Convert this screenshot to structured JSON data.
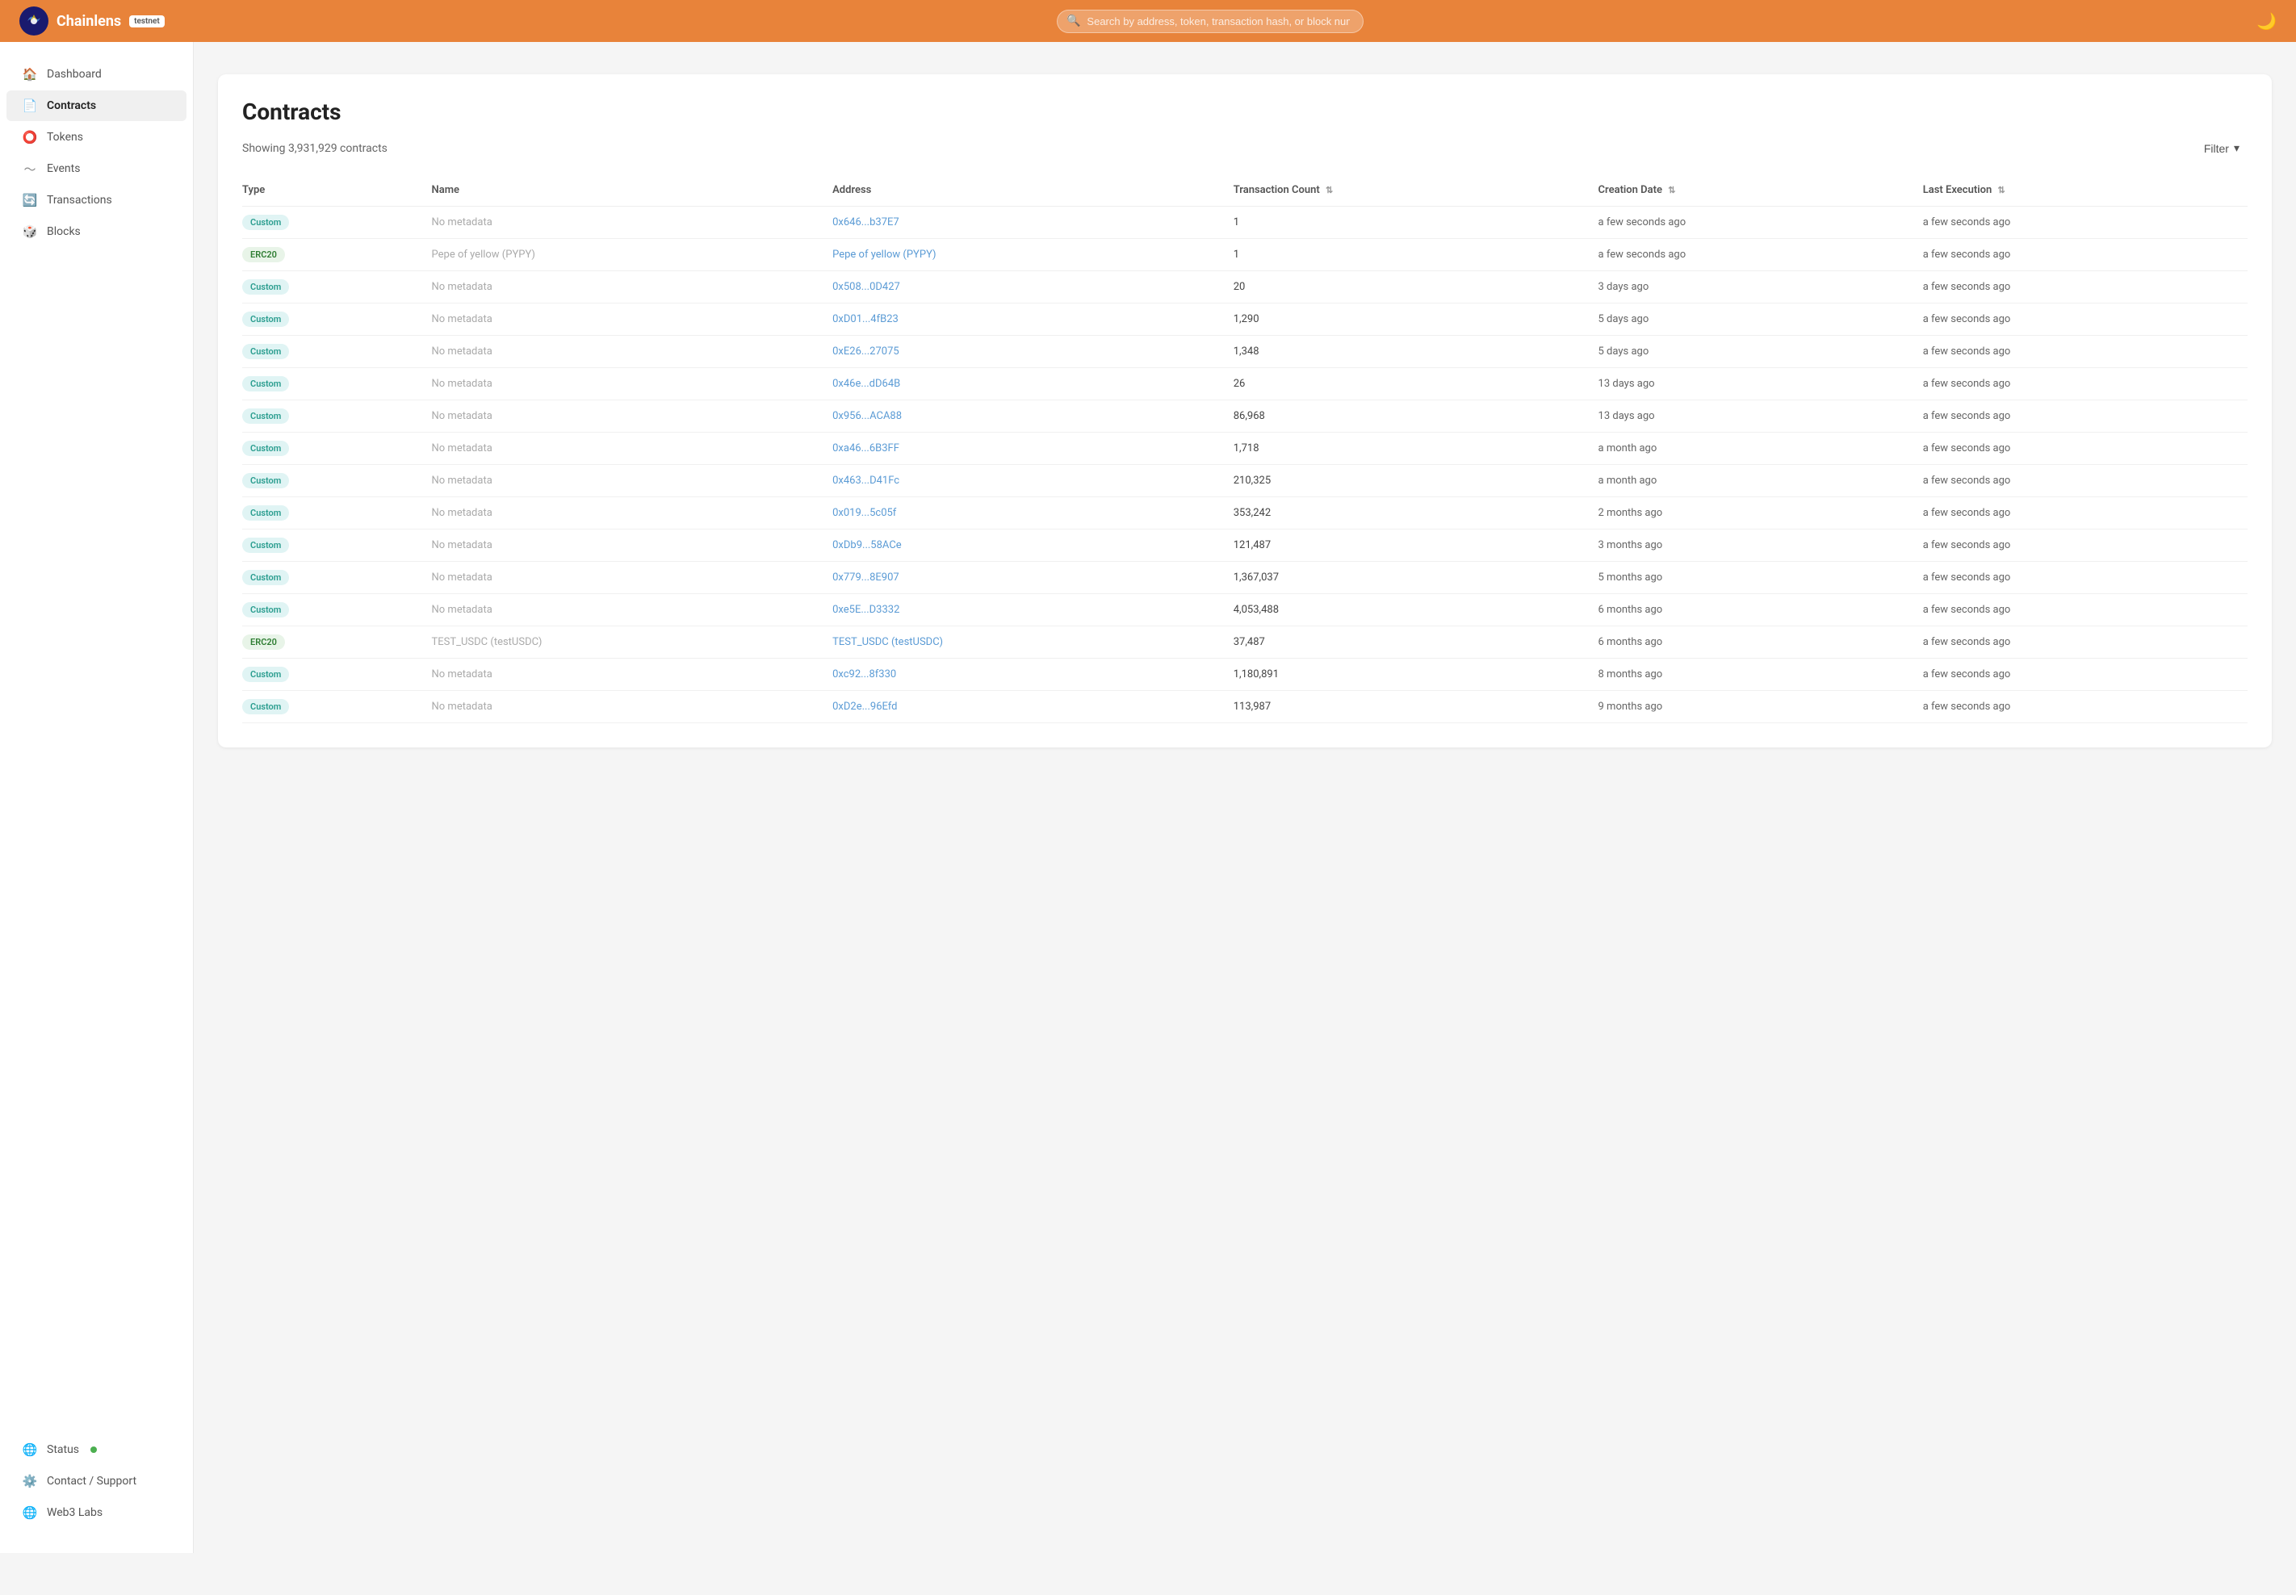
{
  "app": {
    "brand": "Chainlens",
    "badge": "testnet",
    "search_placeholder": "Search by address, token, transaction hash, or block number"
  },
  "sidebar": {
    "nav_items": [
      {
        "id": "dashboard",
        "label": "Dashboard",
        "icon": "🏠",
        "active": false
      },
      {
        "id": "contracts",
        "label": "Contracts",
        "icon": "📄",
        "active": true
      },
      {
        "id": "tokens",
        "label": "Tokens",
        "icon": "⭕",
        "active": false
      },
      {
        "id": "events",
        "label": "Events",
        "icon": "📈",
        "active": false
      },
      {
        "id": "transactions",
        "label": "Transactions",
        "icon": "🔄",
        "active": false
      },
      {
        "id": "blocks",
        "label": "Blocks",
        "icon": "🎲",
        "active": false
      }
    ],
    "bottom_items": [
      {
        "id": "status",
        "label": "Status",
        "icon": "🌐",
        "has_dot": true
      },
      {
        "id": "contact",
        "label": "Contact / Support",
        "icon": "⚙️",
        "has_dot": false
      },
      {
        "id": "web3labs",
        "label": "Web3 Labs",
        "icon": "🌐",
        "has_dot": false
      }
    ]
  },
  "page": {
    "title": "Contracts",
    "showing_text": "Showing 3,931,929 contracts",
    "filter_label": "Filter"
  },
  "table": {
    "columns": [
      {
        "id": "type",
        "label": "Type",
        "sortable": false
      },
      {
        "id": "name",
        "label": "Name",
        "sortable": false
      },
      {
        "id": "address",
        "label": "Address",
        "sortable": false
      },
      {
        "id": "tx_count",
        "label": "Transaction Count",
        "sortable": true
      },
      {
        "id": "creation_date",
        "label": "Creation Date",
        "sortable": true
      },
      {
        "id": "last_execution",
        "label": "Last Execution",
        "sortable": true
      }
    ],
    "rows": [
      {
        "type": "Custom",
        "type_class": "custom",
        "name": "No metadata",
        "address": "0x646...b37E7",
        "tx_count": "1",
        "creation_date": "a few seconds ago",
        "last_execution": "a few seconds ago"
      },
      {
        "type": "ERC20",
        "type_class": "erc20",
        "name": "Pepe of yellow (PYPY)",
        "address": "Pepe of yellow (PYPY)",
        "tx_count": "1",
        "creation_date": "a few seconds ago",
        "last_execution": "a few seconds ago"
      },
      {
        "type": "Custom",
        "type_class": "custom",
        "name": "No metadata",
        "address": "0x508...0D427",
        "tx_count": "20",
        "creation_date": "3 days ago",
        "last_execution": "a few seconds ago"
      },
      {
        "type": "Custom",
        "type_class": "custom",
        "name": "No metadata",
        "address": "0xD01...4fB23",
        "tx_count": "1,290",
        "creation_date": "5 days ago",
        "last_execution": "a few seconds ago"
      },
      {
        "type": "Custom",
        "type_class": "custom",
        "name": "No metadata",
        "address": "0xE26...27075",
        "tx_count": "1,348",
        "creation_date": "5 days ago",
        "last_execution": "a few seconds ago"
      },
      {
        "type": "Custom",
        "type_class": "custom",
        "name": "No metadata",
        "address": "0x46e...dD64B",
        "tx_count": "26",
        "creation_date": "13 days ago",
        "last_execution": "a few seconds ago"
      },
      {
        "type": "Custom",
        "type_class": "custom",
        "name": "No metadata",
        "address": "0x956...ACA88",
        "tx_count": "86,968",
        "creation_date": "13 days ago",
        "last_execution": "a few seconds ago"
      },
      {
        "type": "Custom",
        "type_class": "custom",
        "name": "No metadata",
        "address": "0xa46...6B3FF",
        "tx_count": "1,718",
        "creation_date": "a month ago",
        "last_execution": "a few seconds ago"
      },
      {
        "type": "Custom",
        "type_class": "custom",
        "name": "No metadata",
        "address": "0x463...D41Fc",
        "tx_count": "210,325",
        "creation_date": "a month ago",
        "last_execution": "a few seconds ago"
      },
      {
        "type": "Custom",
        "type_class": "custom",
        "name": "No metadata",
        "address": "0x019...5c05f",
        "tx_count": "353,242",
        "creation_date": "2 months ago",
        "last_execution": "a few seconds ago"
      },
      {
        "type": "Custom",
        "type_class": "custom",
        "name": "No metadata",
        "address": "0xDb9...58ACe",
        "tx_count": "121,487",
        "creation_date": "3 months ago",
        "last_execution": "a few seconds ago"
      },
      {
        "type": "Custom",
        "type_class": "custom",
        "name": "No metadata",
        "address": "0x779...8E907",
        "tx_count": "1,367,037",
        "creation_date": "5 months ago",
        "last_execution": "a few seconds ago"
      },
      {
        "type": "Custom",
        "type_class": "custom",
        "name": "No metadata",
        "address": "0xe5E...D3332",
        "tx_count": "4,053,488",
        "creation_date": "6 months ago",
        "last_execution": "a few seconds ago"
      },
      {
        "type": "ERC20",
        "type_class": "erc20",
        "name": "TEST_USDC (testUSDC)",
        "address": "TEST_USDC (testUSDC)",
        "tx_count": "37,487",
        "creation_date": "6 months ago",
        "last_execution": "a few seconds ago"
      },
      {
        "type": "Custom",
        "type_class": "custom",
        "name": "No metadata",
        "address": "0xc92...8f330",
        "tx_count": "1,180,891",
        "creation_date": "8 months ago",
        "last_execution": "a few seconds ago"
      },
      {
        "type": "Custom",
        "type_class": "custom",
        "name": "No metadata",
        "address": "0xD2e...96Efd",
        "tx_count": "113,987",
        "creation_date": "9 months ago",
        "last_execution": "a few seconds ago"
      }
    ]
  }
}
